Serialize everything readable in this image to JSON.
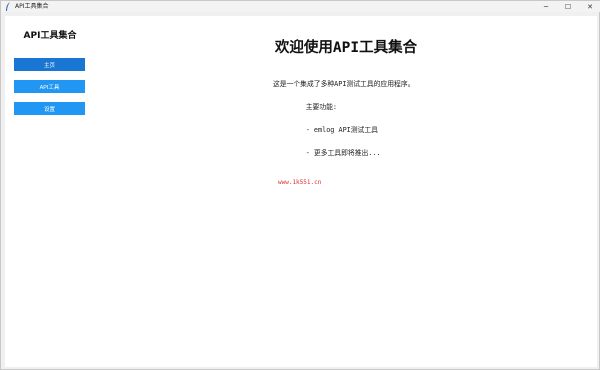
{
  "window": {
    "title": "API工具集合",
    "controls": {
      "minimize": "─",
      "maximize": "☐",
      "close": "✕"
    }
  },
  "sidebar": {
    "title": "API工具集合",
    "items": [
      {
        "label": "主页",
        "active": true
      },
      {
        "label": "API工具",
        "active": false
      },
      {
        "label": "设置",
        "active": false
      }
    ]
  },
  "main": {
    "title": "欢迎使用API工具集合",
    "description_lines": [
      "这是一个集成了多种API测试工具的应用程序。",
      "        主要功能:",
      "        - emlog API测试工具",
      "        - 更多工具即将推出..."
    ]
  },
  "watermark": "www.1k551.cn",
  "colors": {
    "button": "#2196f3",
    "button_active": "#1976d2",
    "watermark": "#e03030"
  }
}
